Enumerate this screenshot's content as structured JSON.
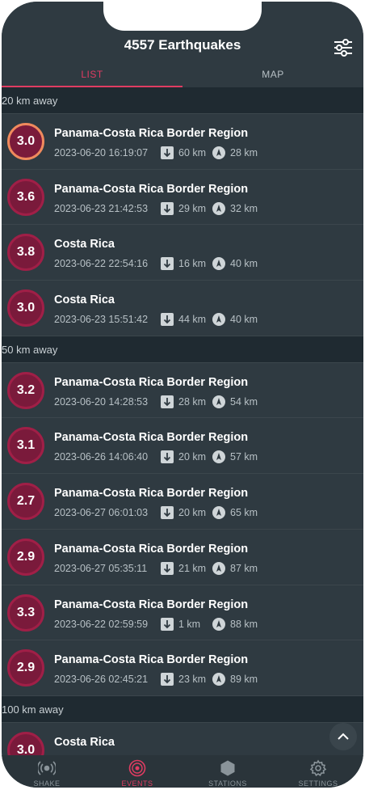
{
  "header": {
    "title": "4557 Earthquakes"
  },
  "tabs": [
    {
      "label": "LIST",
      "active": true
    },
    {
      "label": "MAP",
      "active": false
    }
  ],
  "sections": [
    {
      "title": "20 km away",
      "events": [
        {
          "mag": "3.0",
          "region": "Panama-Costa Rica Border Region",
          "time": "2023-06-20 16:19:07",
          "depth": "60 km",
          "distance": "28 km",
          "ring": "orange"
        },
        {
          "mag": "3.6",
          "region": "Panama-Costa Rica Border Region",
          "time": "2023-06-23 21:42:53",
          "depth": "29 km",
          "distance": "32 km",
          "ring": "red"
        },
        {
          "mag": "3.8",
          "region": "Costa Rica",
          "time": "2023-06-22 22:54:16",
          "depth": "16 km",
          "distance": "40 km",
          "ring": "red"
        },
        {
          "mag": "3.0",
          "region": "Costa Rica",
          "time": "2023-06-23 15:51:42",
          "depth": "44 km",
          "distance": "40 km",
          "ring": "red"
        }
      ]
    },
    {
      "title": "50 km away",
      "events": [
        {
          "mag": "3.2",
          "region": "Panama-Costa Rica Border Region",
          "time": "2023-06-20 14:28:53",
          "depth": "28 km",
          "distance": "54 km",
          "ring": "red"
        },
        {
          "mag": "3.1",
          "region": "Panama-Costa Rica Border Region",
          "time": "2023-06-26 14:06:40",
          "depth": "20 km",
          "distance": "57 km",
          "ring": "red"
        },
        {
          "mag": "2.7",
          "region": "Panama-Costa Rica Border Region",
          "time": "2023-06-27 06:01:03",
          "depth": "20 km",
          "distance": "65 km",
          "ring": "red"
        },
        {
          "mag": "2.9",
          "region": "Panama-Costa Rica Border Region",
          "time": "2023-06-27 05:35:11",
          "depth": "21 km",
          "distance": "87 km",
          "ring": "red"
        },
        {
          "mag": "3.3",
          "region": "Panama-Costa Rica Border Region",
          "time": "2023-06-22 02:59:59",
          "depth": "1 km",
          "distance": "88 km",
          "ring": "red"
        },
        {
          "mag": "2.9",
          "region": "Panama-Costa Rica Border Region",
          "time": "2023-06-26 02:45:21",
          "depth": "23 km",
          "distance": "89 km",
          "ring": "red"
        }
      ]
    },
    {
      "title": "100 km away",
      "events": [
        {
          "mag": "3.0",
          "region": "Costa Rica",
          "time": "",
          "depth": "",
          "distance": "",
          "ring": "red"
        }
      ]
    }
  ],
  "bottom_nav": [
    {
      "label": "SHAKE",
      "icon": "broadcast-icon",
      "active": false
    },
    {
      "label": "EVENTS",
      "icon": "events-icon",
      "active": true
    },
    {
      "label": "STATIONS",
      "icon": "hexagon-icon",
      "active": false
    },
    {
      "label": "SETTINGS",
      "icon": "gear-icon",
      "active": false
    }
  ],
  "colors": {
    "accent": "#e03c62",
    "background": "#2f3a41",
    "section": "#1f2a31"
  }
}
